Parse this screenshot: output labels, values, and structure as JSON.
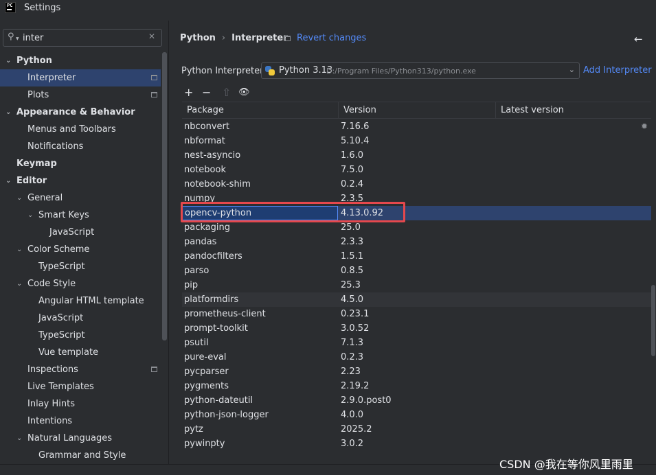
{
  "window": {
    "title": "Settings"
  },
  "search": {
    "value": "inter",
    "placeholder": ""
  },
  "tree": [
    {
      "label": "Python",
      "level": 0,
      "bold": true,
      "expanded": true
    },
    {
      "label": "Interpreter",
      "level": 1,
      "selected": true,
      "page_icon": true
    },
    {
      "label": "Plots",
      "level": 1,
      "page_icon": true
    },
    {
      "label": "Appearance & Behavior",
      "level": 0,
      "bold": true,
      "expanded": true
    },
    {
      "label": "Menus and Toolbars",
      "level": 1
    },
    {
      "label": "Notifications",
      "level": 1
    },
    {
      "label": "Keymap",
      "level": 0,
      "bold": true
    },
    {
      "label": "Editor",
      "level": 0,
      "bold": true,
      "expanded": true
    },
    {
      "label": "General",
      "level": 1,
      "expanded": true
    },
    {
      "label": "Smart Keys",
      "level": 2,
      "expanded": true
    },
    {
      "label": "JavaScript",
      "level": 3
    },
    {
      "label": "Color Scheme",
      "level": 1,
      "expanded": true
    },
    {
      "label": "TypeScript",
      "level": 2
    },
    {
      "label": "Code Style",
      "level": 1,
      "expanded": true
    },
    {
      "label": "Angular HTML template",
      "level": 2
    },
    {
      "label": "JavaScript",
      "level": 2
    },
    {
      "label": "TypeScript",
      "level": 2
    },
    {
      "label": "Vue template",
      "level": 2
    },
    {
      "label": "Inspections",
      "level": 1,
      "page_icon": true
    },
    {
      "label": "Live Templates",
      "level": 1
    },
    {
      "label": "Inlay Hints",
      "level": 1
    },
    {
      "label": "Intentions",
      "level": 1
    },
    {
      "label": "Natural Languages",
      "level": 1,
      "expanded": true
    },
    {
      "label": "Grammar and Style",
      "level": 2
    }
  ],
  "breadcrumb": {
    "parent": "Python",
    "separator": "›",
    "current": "Interpreter"
  },
  "revert_label": "Revert changes",
  "interpreter": {
    "label": "Python Interpreter:",
    "name": "Python 3.13",
    "path": "D:/Program Files/Python313/python.exe",
    "add_label": "Add Interpreter"
  },
  "toolbar": {
    "add": "+",
    "remove": "−",
    "upgrade": "⇧",
    "show": "👁"
  },
  "table": {
    "columns": [
      "Package",
      "Version",
      "Latest version"
    ],
    "rows": [
      [
        "nbconvert",
        "7.16.6",
        ""
      ],
      [
        "nbformat",
        "5.10.4",
        ""
      ],
      [
        "nest-asyncio",
        "1.6.0",
        ""
      ],
      [
        "notebook",
        "7.5.0",
        ""
      ],
      [
        "notebook-shim",
        "0.2.4",
        ""
      ],
      [
        "numpy",
        "2.3.5",
        ""
      ],
      [
        "opencv-python",
        "4.13.0.92",
        ""
      ],
      [
        "packaging",
        "25.0",
        ""
      ],
      [
        "pandas",
        "2.3.3",
        ""
      ],
      [
        "pandocfilters",
        "1.5.1",
        ""
      ],
      [
        "parso",
        "0.8.5",
        ""
      ],
      [
        "pip",
        "25.3",
        ""
      ],
      [
        "platformdirs",
        "4.5.0",
        ""
      ],
      [
        "prometheus-client",
        "0.23.1",
        ""
      ],
      [
        "prompt-toolkit",
        "3.0.52",
        ""
      ],
      [
        "psutil",
        "7.1.3",
        ""
      ],
      [
        "pure-eval",
        "0.2.3",
        ""
      ],
      [
        "pycparser",
        "2.23",
        ""
      ],
      [
        "pygments",
        "2.19.2",
        ""
      ],
      [
        "python-dateutil",
        "2.9.0.post0",
        ""
      ],
      [
        "python-json-logger",
        "4.0.0",
        ""
      ],
      [
        "pytz",
        "2025.2",
        ""
      ],
      [
        "pywinpty",
        "3.0.2",
        ""
      ]
    ],
    "selected_row": 6,
    "hover_row": 12
  },
  "watermark": "CSDN @我在等你风里雨里",
  "colors": {
    "accent": "#548af7",
    "selection": "#2e436e",
    "highlight": "#e5484d"
  }
}
